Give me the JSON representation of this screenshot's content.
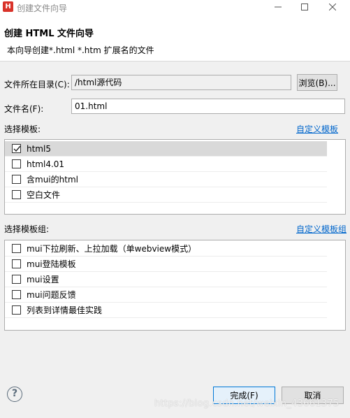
{
  "window": {
    "title": "创建文件向导",
    "icon_letter": "H"
  },
  "header": {
    "title": "创建 HTML 文件向导",
    "description": "本向导创建*.html *.htm 扩展名的文件"
  },
  "form": {
    "dir_label": "文件所在目录(C):",
    "dir_value": "/html源代码",
    "browse_label": "浏览(B)...",
    "filename_label": "文件名(F):",
    "filename_value": "01.html"
  },
  "templates": {
    "label": "选择模板:",
    "custom_link": "自定义模板",
    "items": [
      {
        "label": "html5",
        "checked": true
      },
      {
        "label": "html4.01",
        "checked": false
      },
      {
        "label": "含mui的html",
        "checked": false
      },
      {
        "label": "空白文件",
        "checked": false
      }
    ]
  },
  "template_groups": {
    "label": "选择模板组:",
    "custom_link": "自定义模板组",
    "items": [
      {
        "label": "mui下拉刷新、上拉加载（单webview模式）",
        "checked": false
      },
      {
        "label": "mui登陆模板",
        "checked": false
      },
      {
        "label": "mui设置",
        "checked": false
      },
      {
        "label": "mui问题反馈",
        "checked": false
      },
      {
        "label": "列表到详情最佳实践",
        "checked": false
      }
    ]
  },
  "footer": {
    "finish_label": "完成(F)",
    "cancel_label": "取消",
    "help_icon": "question-circle-icon"
  },
  "watermark": "https://blog.csdn.net/weixin_43661375"
}
